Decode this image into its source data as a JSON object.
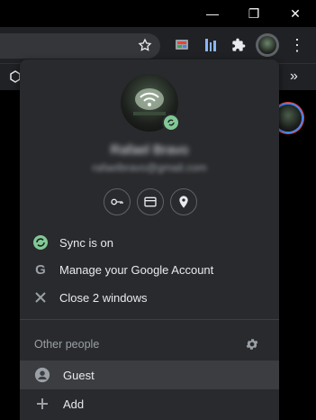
{
  "window": {
    "minimize_glyph": "—",
    "restore_glyph": "❐",
    "close_glyph": "✕"
  },
  "toolbar": {
    "icons": [
      "star-icon",
      "media-router-icon",
      "reading-list-icon",
      "extensions-icon",
      "profile-avatar-icon",
      "more-menu-icon"
    ],
    "more_glyph": "⋮"
  },
  "bookmarks": {
    "overflow_glyph": "»"
  },
  "profile_menu": {
    "name": "Rafael Bravo",
    "email": "rafaelbravo@gmail.com",
    "action_icons": [
      "key-icon",
      "card-icon",
      "location-pin-icon"
    ],
    "items": [
      {
        "label": "Sync is on",
        "icon": "sync-icon"
      },
      {
        "label": "Manage your Google Account",
        "icon": "google-icon"
      },
      {
        "label": "Close 2 windows",
        "icon": "close-icon"
      }
    ],
    "other_people": {
      "title": "Other people",
      "guest_label": "Guest",
      "add_label": "Add"
    }
  },
  "colors": {
    "menu_bg": "#292a2d",
    "sync_green": "#81c995",
    "text": "#e8eaed",
    "muted": "#9aa0a6",
    "guest_highlight": "#3c3d41"
  }
}
